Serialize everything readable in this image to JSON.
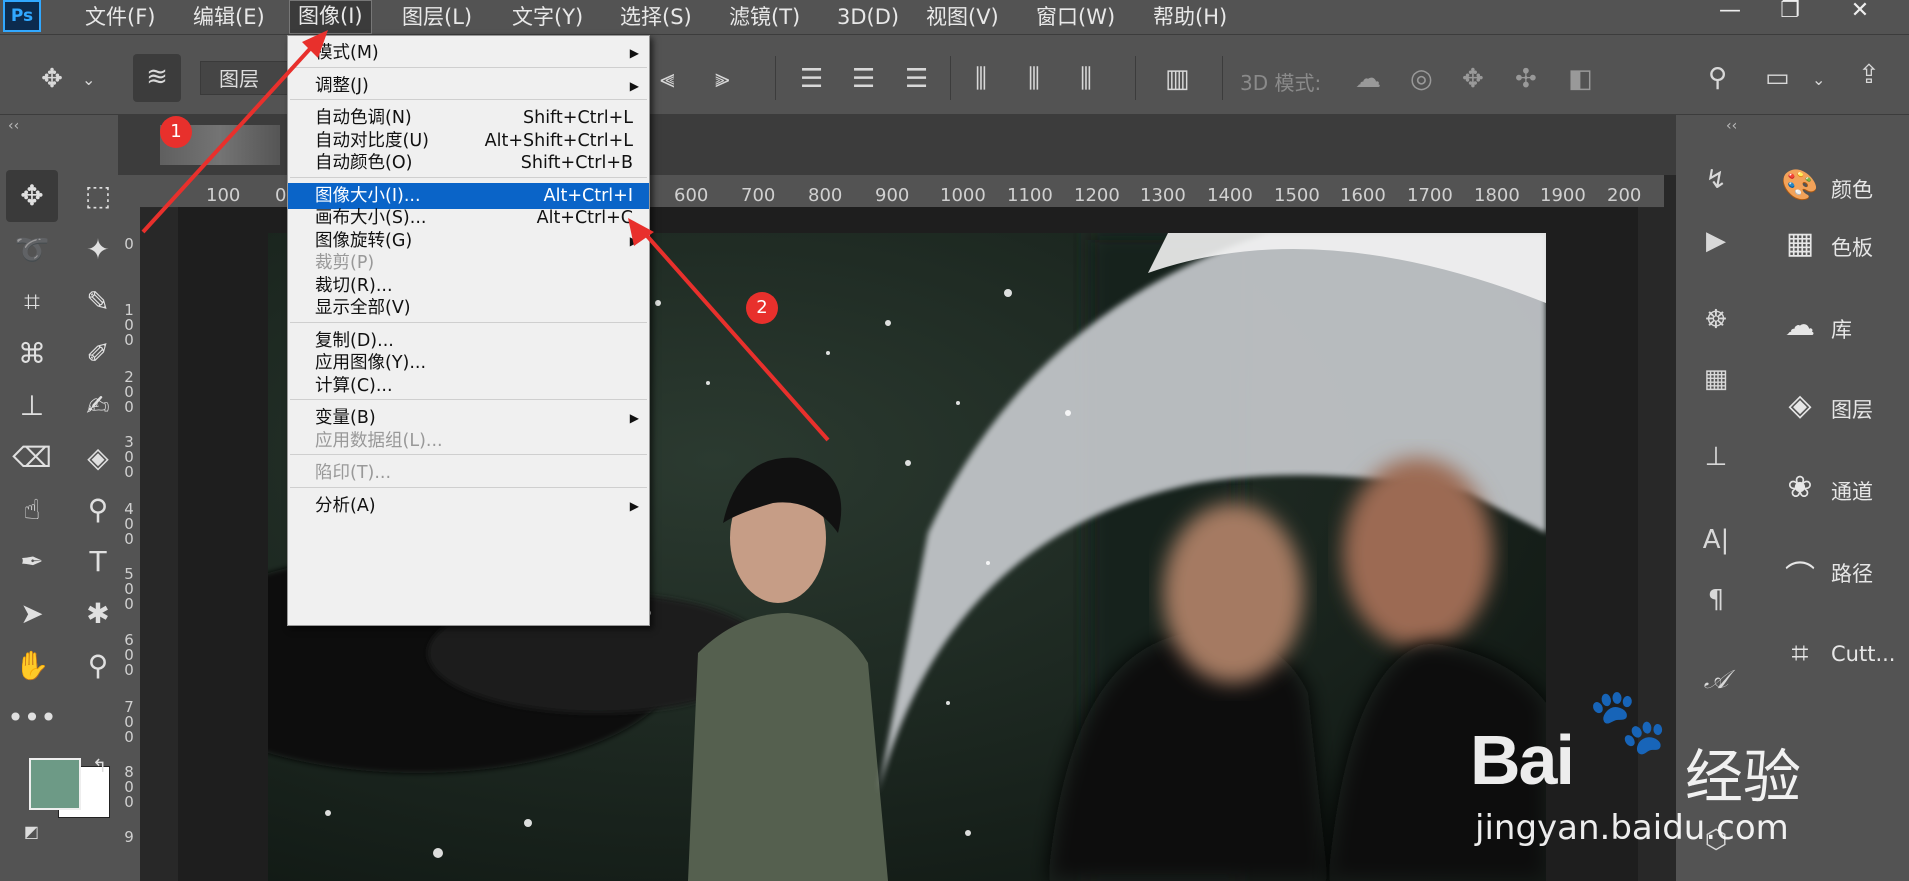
{
  "app": {
    "logo": "Ps"
  },
  "menubar": {
    "items": [
      "文件(F)",
      "编辑(E)",
      "图像(I)",
      "图层(L)",
      "文字(Y)",
      "选择(S)",
      "滤镜(T)",
      "3D(D)",
      "视图(V)",
      "窗口(W)",
      "帮助(H)"
    ],
    "active": "图像(I)"
  },
  "window_controls": {
    "minimize": "—",
    "restore": "❐",
    "close": "✕"
  },
  "options_bar": {
    "layer_dropdown": "图层",
    "mode_3d_label": "3D 模式:"
  },
  "rulers": {
    "horizontal": [
      "100",
      "0",
      "600",
      "700",
      "800",
      "900",
      "1000",
      "1100",
      "1200",
      "1300",
      "1400",
      "1500",
      "1600",
      "1700",
      "1800",
      "1900",
      "200"
    ],
    "vertical": [
      "0",
      "1 0 0",
      "2 0 0",
      "3 0 0",
      "4 0 0",
      "5 0 0",
      "6 0 0",
      "7 0 0",
      "8 0 0",
      "9"
    ]
  },
  "image_menu": {
    "items": [
      {
        "label": "模式(M)",
        "shortcut": "",
        "submenu": true,
        "disabled": false
      },
      {
        "sep": true
      },
      {
        "label": "调整(J)",
        "shortcut": "",
        "submenu": true,
        "disabled": false
      },
      {
        "sep": true
      },
      {
        "label": "自动色调(N)",
        "shortcut": "Shift+Ctrl+L",
        "submenu": false,
        "disabled": false
      },
      {
        "label": "自动对比度(U)",
        "shortcut": "Alt+Shift+Ctrl+L",
        "submenu": false,
        "disabled": false
      },
      {
        "label": "自动颜色(O)",
        "shortcut": "Shift+Ctrl+B",
        "submenu": false,
        "disabled": false
      },
      {
        "sep": true
      },
      {
        "label": "图像大小(I)...",
        "shortcut": "Alt+Ctrl+I",
        "submenu": false,
        "disabled": false,
        "highlighted": true
      },
      {
        "label": "画布大小(S)...",
        "shortcut": "Alt+Ctrl+C",
        "submenu": false,
        "disabled": false
      },
      {
        "label": "图像旋转(G)",
        "shortcut": "",
        "submenu": true,
        "disabled": false
      },
      {
        "label": "裁剪(P)",
        "shortcut": "",
        "submenu": false,
        "disabled": true
      },
      {
        "label": "裁切(R)...",
        "shortcut": "",
        "submenu": false,
        "disabled": false
      },
      {
        "label": "显示全部(V)",
        "shortcut": "",
        "submenu": false,
        "disabled": false
      },
      {
        "sep": true
      },
      {
        "label": "复制(D)...",
        "shortcut": "",
        "submenu": false,
        "disabled": false
      },
      {
        "label": "应用图像(Y)...",
        "shortcut": "",
        "submenu": false,
        "disabled": false
      },
      {
        "label": "计算(C)...",
        "shortcut": "",
        "submenu": false,
        "disabled": false
      },
      {
        "sep": true
      },
      {
        "label": "变量(B)",
        "shortcut": "",
        "submenu": true,
        "disabled": false
      },
      {
        "label": "应用数据组(L)...",
        "shortcut": "",
        "submenu": false,
        "disabled": true
      },
      {
        "sep": true
      },
      {
        "label": "陷印(T)...",
        "shortcut": "",
        "submenu": false,
        "disabled": true
      },
      {
        "sep": true
      },
      {
        "label": "分析(A)",
        "shortcut": "",
        "submenu": true,
        "disabled": false
      }
    ]
  },
  "panels": {
    "items": [
      "颜色",
      "色板",
      "库",
      "图层",
      "通道",
      "路径",
      "Cutt..."
    ]
  },
  "annotations": {
    "step1": "1",
    "step2": "2"
  },
  "watermark": {
    "brand": "Bai",
    "brand_suffix": "经验",
    "url": "jingyan.baidu.com"
  },
  "colors": {
    "foreground": "#6d9a86",
    "background": "#ffffff",
    "highlight": "#0a64c8",
    "annotation": "#e8302c"
  }
}
